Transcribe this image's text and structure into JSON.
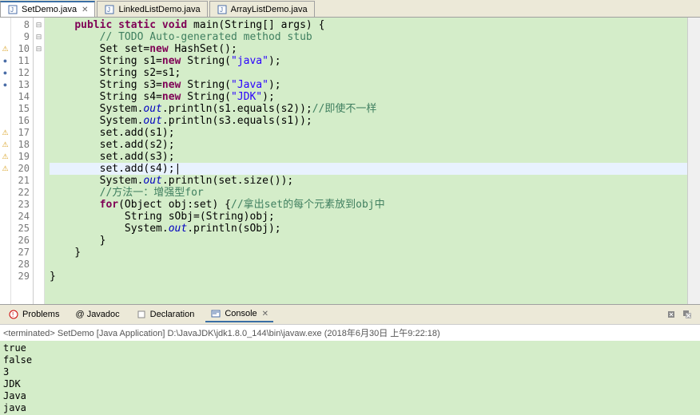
{
  "tabs": [
    {
      "label": "SetDemo.java",
      "active": true,
      "close": true
    },
    {
      "label": "LinkedListDemo.java",
      "active": false,
      "close": false
    },
    {
      "label": "ArrayListDemo.java",
      "active": false,
      "close": false
    }
  ],
  "gutter_start": 8,
  "code_lines": [
    {
      "n": 8,
      "marker": "",
      "fold": "⊟",
      "html": "    <span class='kw'>public</span> <span class='kw'>static</span> <span class='kw'>void</span> main(String[] args) {"
    },
    {
      "n": 9,
      "marker": "",
      "fold": "",
      "html": "        <span class='cmt'>// TODO Auto-generated method stub</span>"
    },
    {
      "n": 10,
      "marker": "warn",
      "fold": "",
      "html": "        Set set=<span class='kw'>new</span> HashSet();"
    },
    {
      "n": 11,
      "marker": "bp",
      "fold": "",
      "html": "        String s1=<span class='kw'>new</span> String(<span class='str'>\"java\"</span>);"
    },
    {
      "n": 12,
      "marker": "bp",
      "fold": "",
      "html": "        String s2=s1;"
    },
    {
      "n": 13,
      "marker": "bp",
      "fold": "",
      "html": "        String s3=<span class='kw'>new</span> String(<span class='str'>\"Java\"</span>);"
    },
    {
      "n": 14,
      "marker": "",
      "fold": "",
      "html": "        String s4=<span class='kw'>new</span> String(<span class='str'>\"JDK\"</span>);"
    },
    {
      "n": 15,
      "marker": "",
      "fold": "",
      "html": "        System.<span class='fld'>out</span>.println(s1.equals(s2));<span class='cmt'>//即使不一样</span>"
    },
    {
      "n": 16,
      "marker": "",
      "fold": "",
      "html": "        System.<span class='fld'>out</span>.println(s3.equals(s1));"
    },
    {
      "n": 17,
      "marker": "warn",
      "fold": "",
      "html": "        set.add(s1);"
    },
    {
      "n": 18,
      "marker": "warn",
      "fold": "",
      "html": "        set.add(s2);"
    },
    {
      "n": 19,
      "marker": "warn",
      "fold": "",
      "html": "        set.add(s3);"
    },
    {
      "n": 20,
      "marker": "warn",
      "fold": "",
      "html": "        set.add(s4);|",
      "hl": true
    },
    {
      "n": 21,
      "marker": "",
      "fold": "",
      "html": "        System.<span class='fld'>out</span>.println(set.size());"
    },
    {
      "n": 22,
      "marker": "",
      "fold": "",
      "html": "        <span class='cmt'>//方法一：增强型for</span>"
    },
    {
      "n": 23,
      "marker": "",
      "fold": "⊟",
      "html": "        <span class='kw'>for</span>(Object obj:set) {<span class='cmt'>//拿出set的每个元素放到obj中</span>"
    },
    {
      "n": 24,
      "marker": "",
      "fold": "",
      "html": "            String sObj=(String)obj;"
    },
    {
      "n": 25,
      "marker": "",
      "fold": "",
      "html": "            System.<span class='fld'>out</span>.println(sObj);"
    },
    {
      "n": 26,
      "marker": "",
      "fold": "",
      "html": "        }"
    },
    {
      "n": 27,
      "marker": "",
      "fold": "",
      "html": "    }"
    },
    {
      "n": 28,
      "marker": "",
      "fold": "",
      "html": ""
    },
    {
      "n": 29,
      "marker": "",
      "fold": "⊟",
      "html": "}"
    }
  ],
  "bottom_tabs": {
    "problems": "Problems",
    "javadoc": "@ Javadoc",
    "declaration": "Declaration",
    "console": "Console",
    "console_close": "✕"
  },
  "terminated": "<terminated> SetDemo [Java Application] D:\\JavaJDK\\jdk1.8.0_144\\bin\\javaw.exe (2018年6月30日 上午9:22:18)",
  "console_output": [
    "true",
    "false",
    "3",
    "JDK",
    "Java",
    "java"
  ]
}
